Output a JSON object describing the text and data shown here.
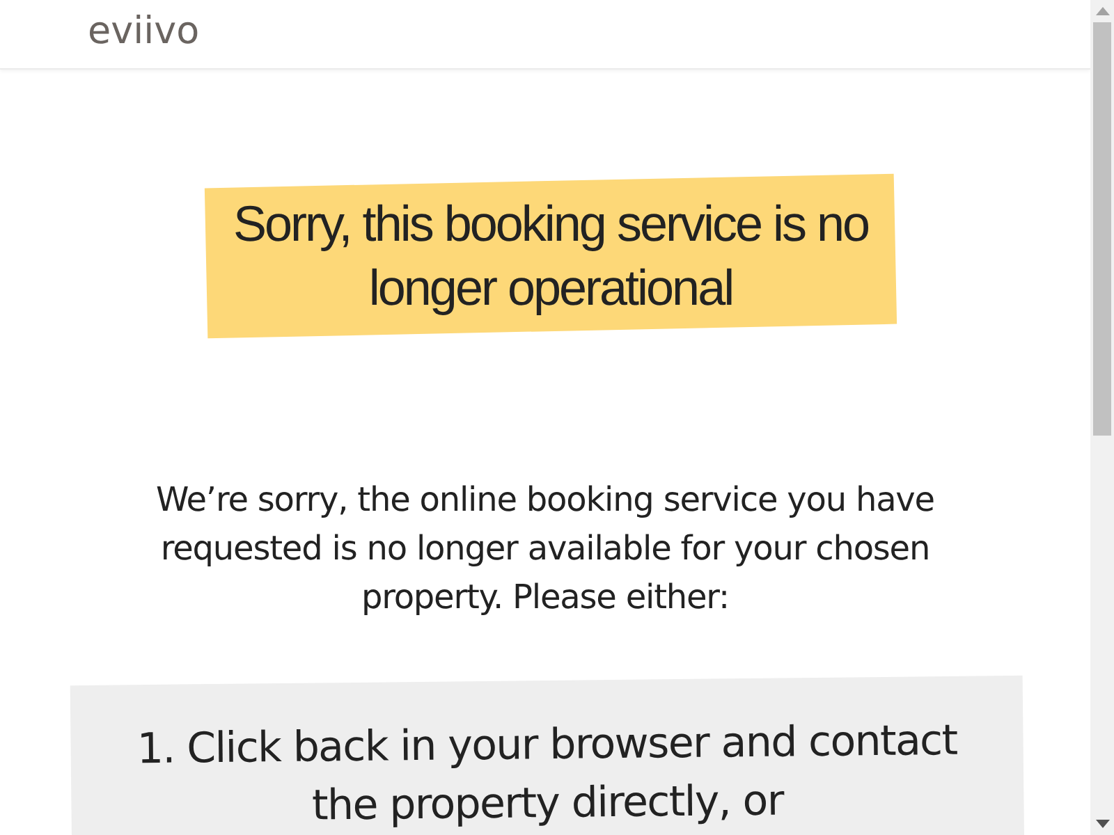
{
  "header": {
    "logo": "eviivo"
  },
  "heading": "Sorry, this booking service is no longer operational",
  "message": "We’re sorry, the online booking service you have requested is no longer available for your chosen property. Please either:",
  "options": [
    "1. Click back in your browser and contact the property directly, or"
  ]
}
